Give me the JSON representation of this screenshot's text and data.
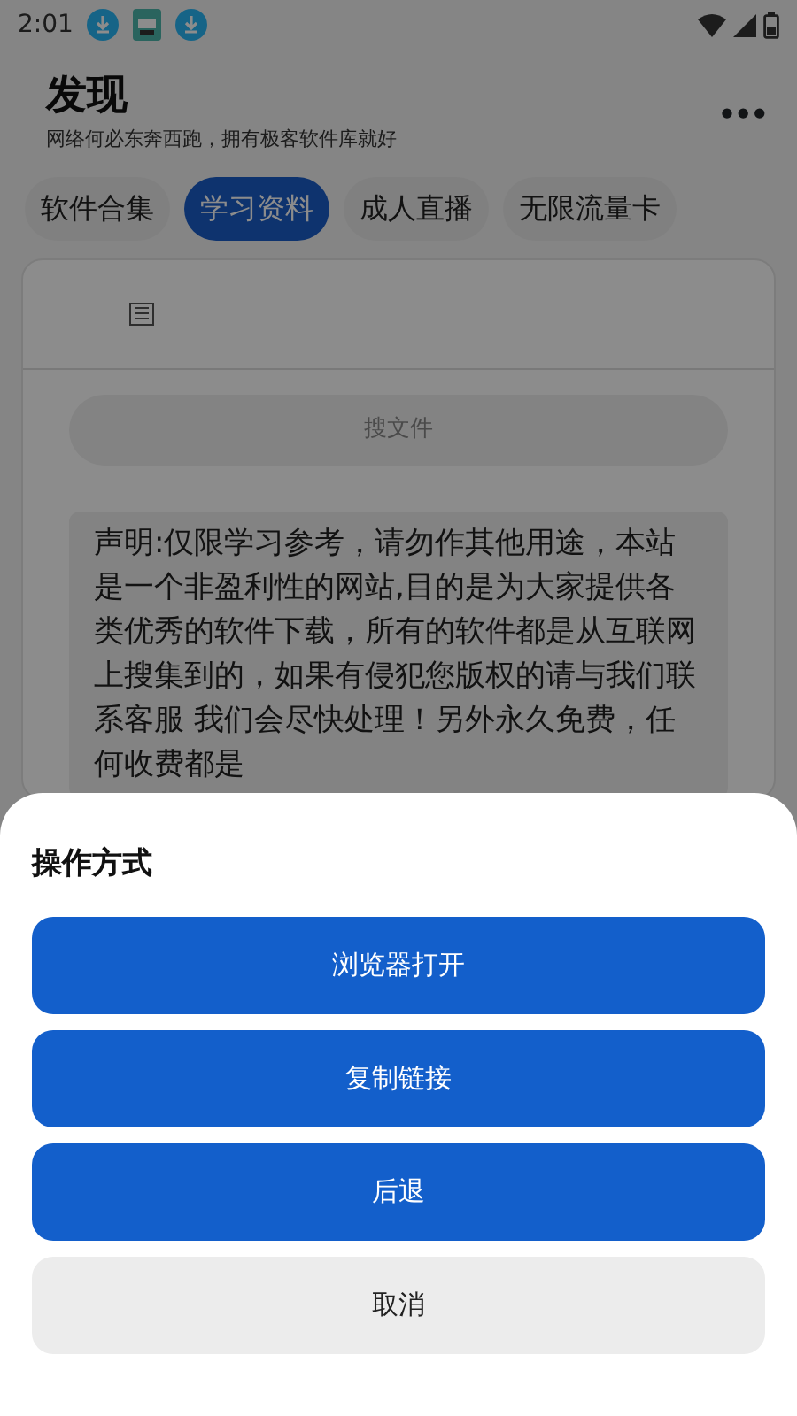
{
  "status_bar": {
    "time": "2:01"
  },
  "header": {
    "title": "发现",
    "subtitle": "网络何必东奔西跑，拥有极客软件库就好",
    "menu": "•••"
  },
  "tabs": [
    {
      "label": "软件合集",
      "selected": false
    },
    {
      "label": "学习资料",
      "selected": true
    },
    {
      "label": "成人直播",
      "selected": false
    },
    {
      "label": "无限流量卡",
      "selected": false
    }
  ],
  "search": {
    "placeholder": "搜文件"
  },
  "notice": "声明:仅限学习参考，请勿作其他用途，本站是一个非盈利性的网站,目的是为大家提供各类优秀的软件下载，所有的软件都是从互联网上搜集到的，如果有侵犯您版权的请与我们联系客服 我们会尽快处理！另外永久免费，任何收费都是",
  "sheet": {
    "title": "操作方式",
    "actions": [
      {
        "label": "浏览器打开",
        "kind": "primary"
      },
      {
        "label": "复制链接",
        "kind": "primary"
      },
      {
        "label": "后退",
        "kind": "primary"
      },
      {
        "label": "取消",
        "kind": "cancel"
      }
    ]
  }
}
